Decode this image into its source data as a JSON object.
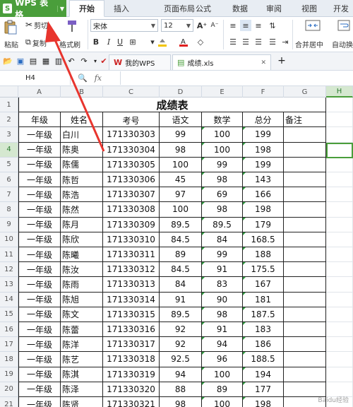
{
  "app": {
    "name": "WPS 表格"
  },
  "ribbon_tabs": [
    "开始",
    "插入",
    "页面布局",
    "公式",
    "数据",
    "审阅",
    "视图",
    "开发"
  ],
  "ribbon": {
    "paste": "粘贴",
    "cut": "剪切",
    "copy": "复制",
    "format_painter": "格式刷",
    "font_name": "宋体",
    "font_size": "12",
    "merge_center": "合并居中",
    "auto_wrap": "自动换"
  },
  "doc_tabs": [
    {
      "label": "我的WPS"
    },
    {
      "label": "成绩.xls"
    }
  ],
  "formula_bar": {
    "name_box": "H4",
    "fx": "fx",
    "value": ""
  },
  "columns": [
    "A",
    "B",
    "C",
    "D",
    "E",
    "F",
    "G",
    "H"
  ],
  "sheet": {
    "title": "成绩表",
    "headers": [
      "年级",
      "姓名",
      "考号",
      "语文",
      "数学",
      "总分",
      "备注"
    ],
    "rows": [
      [
        "3",
        "一年级",
        "白川",
        "171330303",
        "99",
        "100",
        "199"
      ],
      [
        "4",
        "一年级",
        "陈奥",
        "171330304",
        "98",
        "100",
        "198"
      ],
      [
        "5",
        "一年级",
        "陈儒",
        "171330305",
        "100",
        "99",
        "199"
      ],
      [
        "6",
        "一年级",
        "陈哲",
        "171330306",
        "45",
        "98",
        "143"
      ],
      [
        "7",
        "一年级",
        "陈浩",
        "171330307",
        "97",
        "69",
        "166"
      ],
      [
        "8",
        "一年级",
        "陈然",
        "171330308",
        "100",
        "98",
        "198"
      ],
      [
        "9",
        "一年级",
        "陈月",
        "171330309",
        "89.5",
        "89.5",
        "179"
      ],
      [
        "10",
        "一年级",
        "陈欣",
        "171330310",
        "84.5",
        "84",
        "168.5"
      ],
      [
        "11",
        "一年级",
        "陈曦",
        "171330311",
        "89",
        "99",
        "188"
      ],
      [
        "12",
        "一年级",
        "陈汝",
        "171330312",
        "84.5",
        "91",
        "175.5"
      ],
      [
        "13",
        "一年级",
        "陈雨",
        "171330313",
        "84",
        "83",
        "167"
      ],
      [
        "14",
        "一年级",
        "陈旭",
        "171330314",
        "91",
        "90",
        "181"
      ],
      [
        "15",
        "一年级",
        "陈文",
        "171330315",
        "89.5",
        "98",
        "187.5"
      ],
      [
        "16",
        "一年级",
        "陈蕾",
        "171330316",
        "92",
        "91",
        "183"
      ],
      [
        "17",
        "一年级",
        "陈洋",
        "171330317",
        "92",
        "94",
        "186"
      ],
      [
        "18",
        "一年级",
        "陈艺",
        "171330318",
        "92.5",
        "96",
        "188.5"
      ],
      [
        "19",
        "一年级",
        "陈淇",
        "171330319",
        "94",
        "100",
        "194"
      ],
      [
        "20",
        "一年级",
        "陈泽",
        "171330320",
        "88",
        "89",
        "177"
      ],
      [
        "21",
        "一年级",
        "陈贤",
        "171330321",
        "98",
        "100",
        "198"
      ]
    ]
  },
  "watermark": "Baidu经验",
  "colors": {
    "brand_green": "#4a9e3b",
    "arrow_red": "#e8352e"
  }
}
